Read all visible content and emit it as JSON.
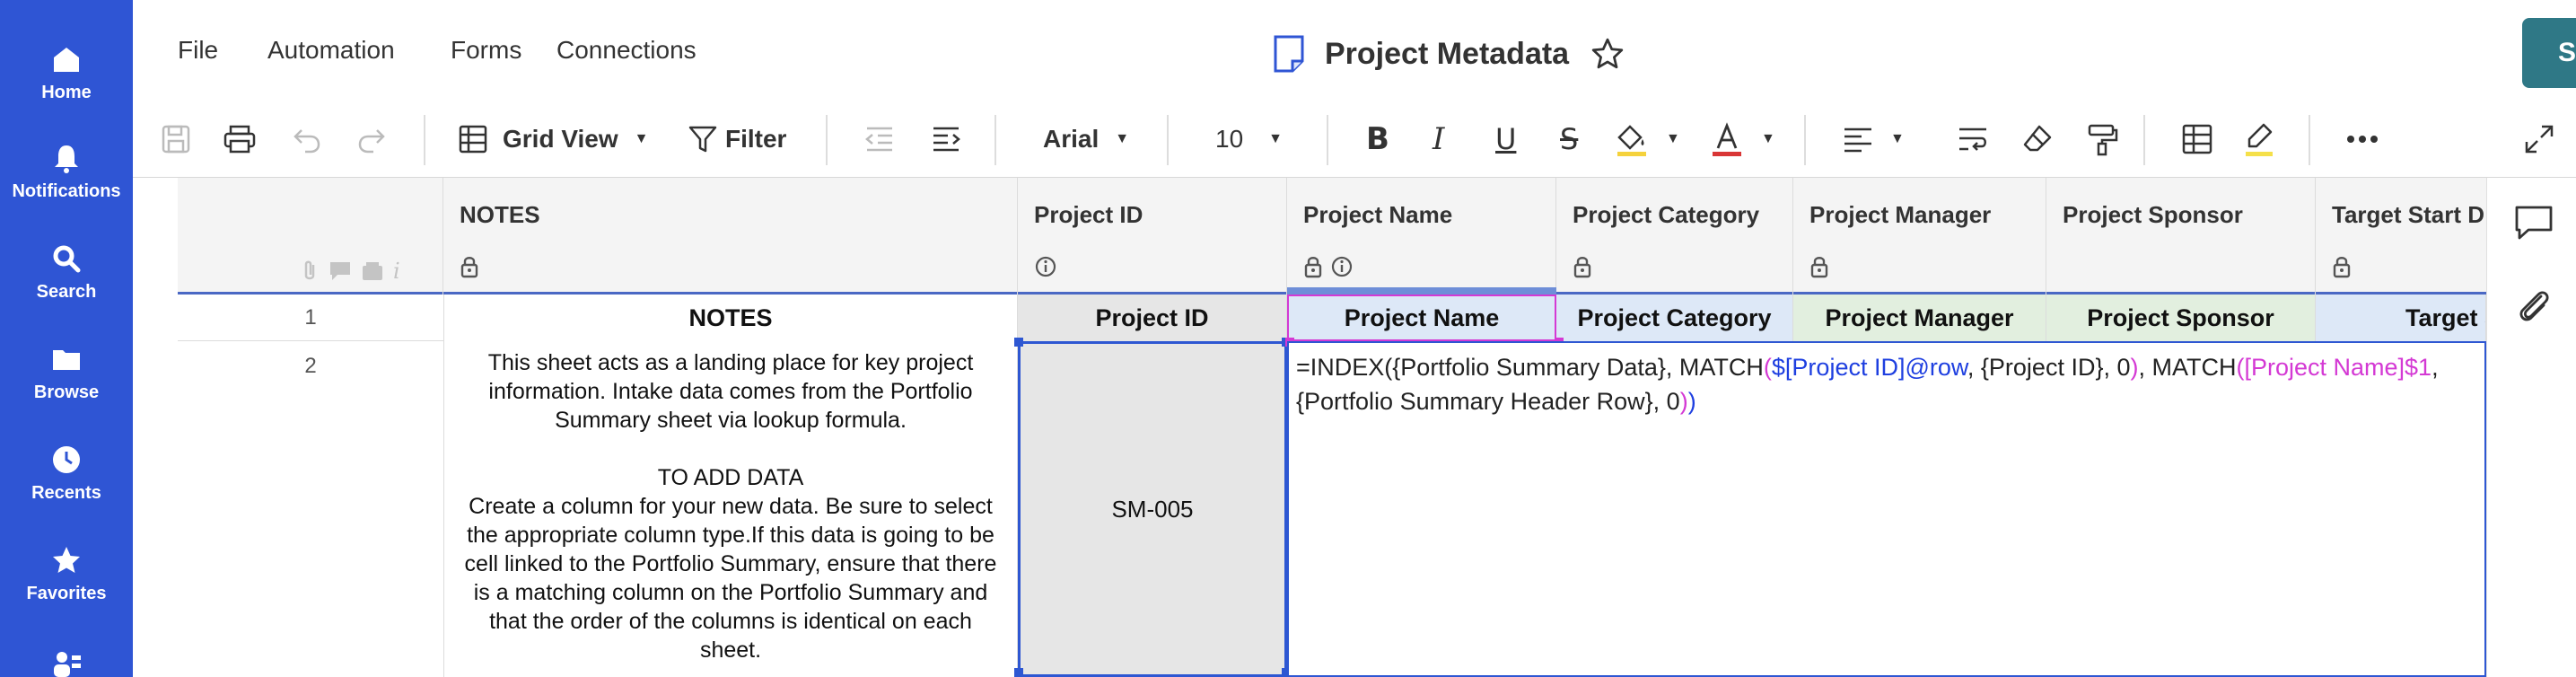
{
  "nav": {
    "items": [
      {
        "label": "Home",
        "icon": "home-icon"
      },
      {
        "label": "Notifications",
        "icon": "bell-icon"
      },
      {
        "label": "Search",
        "icon": "search-icon"
      },
      {
        "label": "Browse",
        "icon": "folder-icon"
      },
      {
        "label": "Recents",
        "icon": "clock-icon"
      },
      {
        "label": "Favorites",
        "icon": "star-icon"
      }
    ]
  },
  "menu": {
    "file": "File",
    "automation": "Automation",
    "forms": "Forms",
    "connections": "Connections"
  },
  "sheet": {
    "title": "Project Metadata"
  },
  "share": {
    "label": "Share"
  },
  "toolbar": {
    "view": "Grid View",
    "filter": "Filter",
    "font": "Arial",
    "size": "10"
  },
  "columns": [
    {
      "name": "NOTES"
    },
    {
      "name": "Project ID"
    },
    {
      "name": "Project Name"
    },
    {
      "name": "Project Category"
    },
    {
      "name": "Project Manager"
    },
    {
      "name": "Project Sponsor"
    },
    {
      "name": "Target Start D"
    }
  ],
  "rows": {
    "r1": {
      "num": "1",
      "cells": [
        "NOTES",
        "Project ID",
        "Project Name",
        "Project Category",
        "Project Manager",
        "Project Sponsor",
        "Target St"
      ]
    },
    "r2": {
      "num": "2",
      "notes": "This sheet acts as a landing place for key project information. Intake data comes from the Portfolio Summary sheet via lookup formula.\n\nTO ADD DATA\nCreate a column for your new data. Be sure to select the appropriate column type.If this data is going to be cell linked to the Portfolio Summary, ensure that there is a matching column on the Portfolio Summary and that the order of the columns is identical on each sheet.",
      "project_id": "SM-005",
      "formula": {
        "p1": "=INDEX({Portfolio Summary Data}, MATCH",
        "p2": "(",
        "p3": "$[Project ID]@row",
        "p4": ", {Project ID}, 0",
        "p5": ")",
        "p6": ", MATCH",
        "p7": "(",
        "p8": "[Project Name]$1",
        "p9": ", {Portfolio Summary Header Row}, 0",
        "p10": ")",
        "p11": ")"
      }
    }
  },
  "colors": {
    "nav_bg": "#2f55d4",
    "share_bg": "#2f7886",
    "selection": "#2e57d2",
    "row1_blue": "#dde8f7",
    "row1_green": "#e2efdf",
    "row1_grey": "#e6e6e6"
  }
}
